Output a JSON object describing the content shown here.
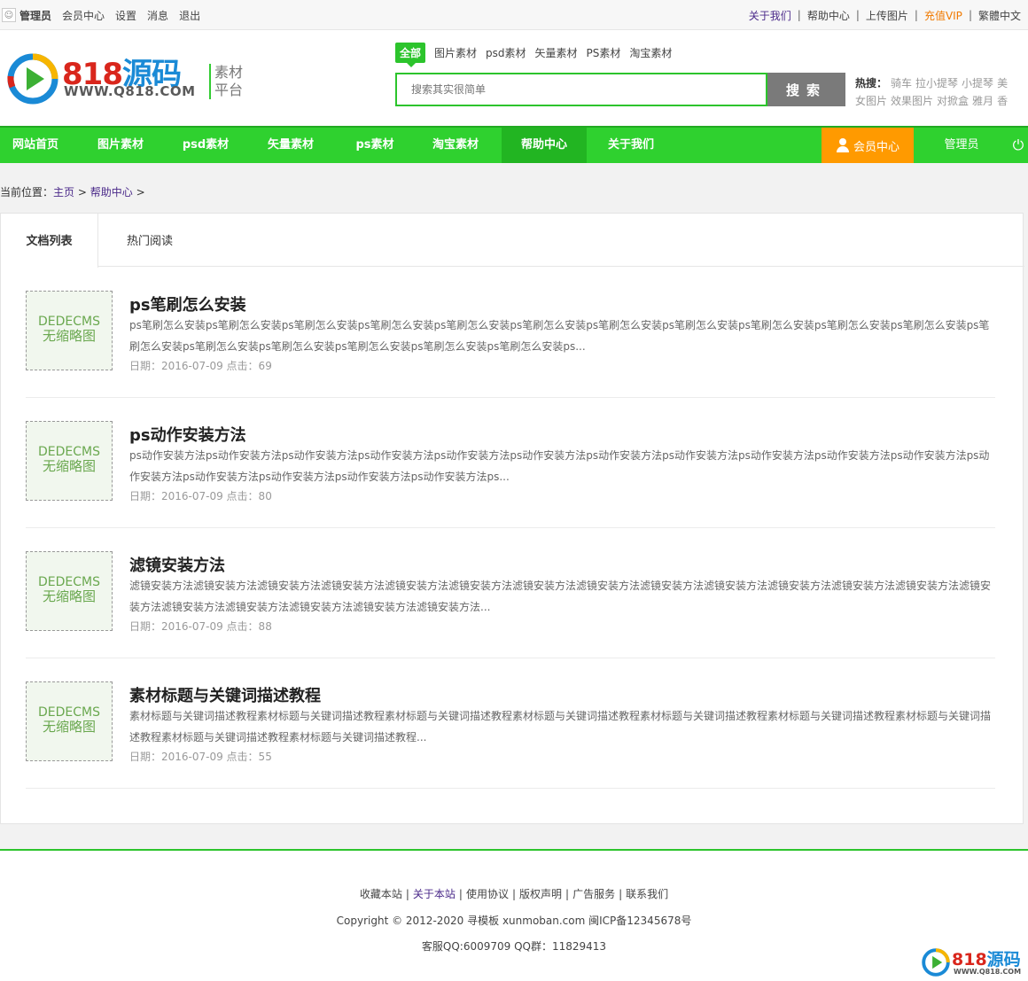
{
  "topbar": {
    "user": "管理员",
    "left_items": [
      "会员中心",
      "设置",
      "消息",
      "退出"
    ],
    "right_items": [
      {
        "label": "关于我们",
        "style": "purple"
      },
      {
        "label": "帮助中心",
        "style": "normal"
      },
      {
        "label": "上传图片",
        "style": "normal"
      },
      {
        "label": "充值VIP",
        "style": "orange"
      },
      {
        "label": "繁體中文",
        "style": "normal"
      }
    ],
    "separator": "|"
  },
  "logo": {
    "num": "818",
    "cn": "源码",
    "url": "WWW.Q818.COM",
    "slogan_1": "素材",
    "slogan_2": "平台"
  },
  "search": {
    "tabs": [
      "全部",
      "图片素材",
      "psd素材",
      "矢量素材",
      "PS素材",
      "淘宝素材"
    ],
    "placeholder": "搜索其实很简单",
    "button": "搜索",
    "hot_label": "热搜：",
    "hot_words": [
      "骑车",
      "拉小提琴",
      "小提琴",
      "美女图片",
      "效果图片",
      "对掀盒",
      "雅月",
      "香"
    ]
  },
  "nav": {
    "items": [
      "网站首页",
      "图片素材",
      "psd素材",
      "矢量素材",
      "ps素材",
      "淘宝素材",
      "帮助中心",
      "关于我们"
    ],
    "active_index": 6,
    "member": "会员中心",
    "admin": "管理员",
    "power_symbol": "⏻"
  },
  "breadcrumb": {
    "prefix": "当前位置：",
    "home": "主页",
    "sep": ">",
    "current": "帮助中心"
  },
  "tabs": [
    "文档列表",
    "热门阅读"
  ],
  "thumb_text": {
    "line1": "DEDECMS",
    "line2": "无缩略图"
  },
  "articles": [
    {
      "title": "ps笔刷怎么安装",
      "desc": "ps笔刷怎么安装ps笔刷怎么安装ps笔刷怎么安装ps笔刷怎么安装ps笔刷怎么安装ps笔刷怎么安装ps笔刷怎么安装ps笔刷怎么安装ps笔刷怎么安装ps笔刷怎么安装ps笔刷怎么安装ps笔刷怎么安装ps笔刷怎么安装ps笔刷怎么安装ps笔刷怎么安装ps笔刷怎么安装ps笔刷怎么安装ps...",
      "meta": "日期：2016-07-09 点击：69"
    },
    {
      "title": "ps动作安装方法",
      "desc": "ps动作安装方法ps动作安装方法ps动作安装方法ps动作安装方法ps动作安装方法ps动作安装方法ps动作安装方法ps动作安装方法ps动作安装方法ps动作安装方法ps动作安装方法ps动作安装方法ps动作安装方法ps动作安装方法ps动作安装方法ps动作安装方法ps...",
      "meta": "日期：2016-07-09 点击：80"
    },
    {
      "title": "滤镜安装方法",
      "desc": "滤镜安装方法滤镜安装方法滤镜安装方法滤镜安装方法滤镜安装方法滤镜安装方法滤镜安装方法滤镜安装方法滤镜安装方法滤镜安装方法滤镜安装方法滤镜安装方法滤镜安装方法滤镜安装方法滤镜安装方法滤镜安装方法滤镜安装方法滤镜安装方法滤镜安装方法...",
      "meta": "日期：2016-07-09 点击：88"
    },
    {
      "title": "素材标题与关键词描述教程",
      "desc": "素材标题与关键词描述教程素材标题与关键词描述教程素材标题与关键词描述教程素材标题与关键词描述教程素材标题与关键词描述教程素材标题与关键词描述教程素材标题与关键词描述教程素材标题与关键词描述教程素材标题与关键词描述教程...",
      "meta": "日期：2016-07-09 点击：55"
    }
  ],
  "footer": {
    "links": [
      {
        "label": "收藏本站",
        "style": "normal"
      },
      {
        "label": "关于本站",
        "style": "purple"
      },
      {
        "label": "使用协议",
        "style": "normal"
      },
      {
        "label": "版权声明",
        "style": "normal"
      },
      {
        "label": "广告服务",
        "style": "normal"
      },
      {
        "label": "联系我们",
        "style": "normal"
      }
    ],
    "copyright": "Copyright © 2012-2020 寻模板 xunmoban.com 闽ICP备12345678号",
    "qq": "客服QQ:6009709 QQ群：11829413",
    "logo_num": "818",
    "logo_cn": "源码",
    "logo_url": "WWW.Q818.COM"
  },
  "colors": {
    "accent": "#2cc42c",
    "nav": "#2fd12f",
    "member": "#ff9a00",
    "search_button": "#7a7a7a"
  }
}
